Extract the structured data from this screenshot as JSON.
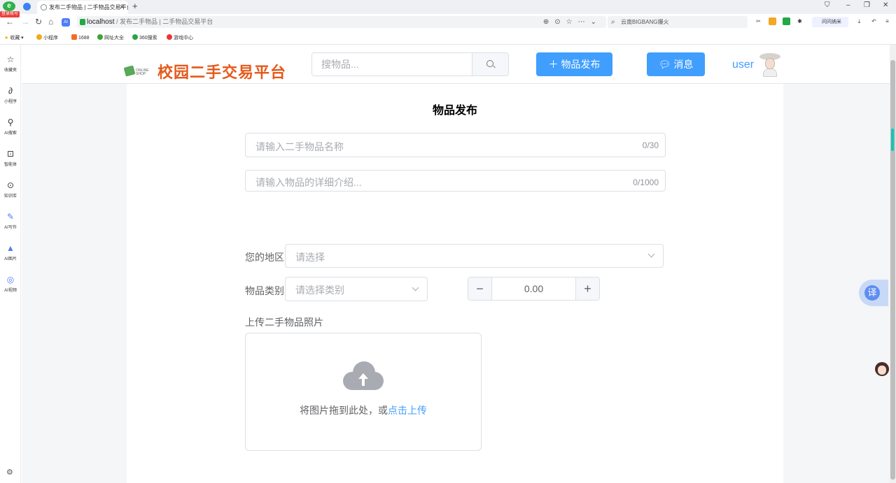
{
  "browser": {
    "login_badge": "登录账号",
    "tab_title": "发布二手物品 | 二手物品交易平台",
    "url_host": "localhost",
    "url_rest": " / 发布二手物品 | 二手物品交易平台",
    "search_text": "云南BIGBANG爆火",
    "ext_label": "问问纳米",
    "bookmarks": [
      "收藏",
      "小程序",
      "1688",
      "网址大全",
      "360搜索",
      "游戏中心"
    ]
  },
  "sidebar": {
    "items": [
      {
        "label": "收藏夹",
        "icon": "star-icon"
      },
      {
        "label": "小程序",
        "icon": "miniapp-icon"
      },
      {
        "label": "AI搜索",
        "icon": "search-icon"
      },
      {
        "label": "智能体",
        "icon": "agent-icon"
      },
      {
        "label": "知识库",
        "icon": "knowledge-icon"
      },
      {
        "label": "AI写作",
        "icon": "edit-icon"
      },
      {
        "label": "AI图片",
        "icon": "image-icon"
      },
      {
        "label": "AI视频",
        "icon": "video-icon"
      }
    ]
  },
  "header": {
    "site_title": "校园二手交易平台",
    "search_placeholder": "搜物品...",
    "publish_label": "物品发布",
    "message_label": "消息",
    "username": "user"
  },
  "form": {
    "page_title": "物品发布",
    "name_placeholder": "请输入二手物品名称",
    "name_count": "0/30",
    "desc_placeholder": "请输入物品的详细介绍...",
    "desc_count": "0/1000",
    "region_label": "您的地区",
    "region_placeholder": "请选择",
    "category_label": "物品类别",
    "category_placeholder": "请选择类别",
    "price_value": "0.00",
    "upload_label": "上传二手物品照片",
    "upload_hint": "将图片拖到此处，或",
    "upload_link": "点击上传"
  },
  "floating": {
    "translate_label": "译"
  },
  "colors": {
    "primary": "#409eff",
    "brand_title": "#e45a1b"
  }
}
